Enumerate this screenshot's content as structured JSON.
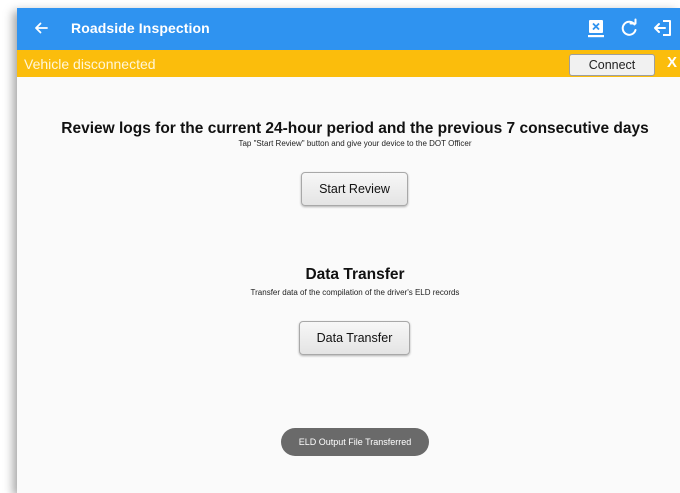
{
  "appbar": {
    "title": "Roadside Inspection",
    "color": "#2f93f0",
    "icons": [
      "back-arrow-icon",
      "close-box-icon",
      "refresh-icon",
      "exit-icon"
    ]
  },
  "banner": {
    "text": "Vehicle disconnected",
    "connect_label": "Connect",
    "close_label": "X",
    "color": "#fbbd0c"
  },
  "review": {
    "heading": "Review logs for the current 24-hour period and the previous 7 consecutive days",
    "subtext": "Tap \"Start Review\" button and give your device to the DOT Officer",
    "button_label": "Start Review"
  },
  "transfer": {
    "heading": "Data Transfer",
    "subtext": "Transfer data of the compilation of the driver's ELD records",
    "button_label": "Data Transfer"
  },
  "toast": {
    "text": "ELD Output File Transferred"
  }
}
